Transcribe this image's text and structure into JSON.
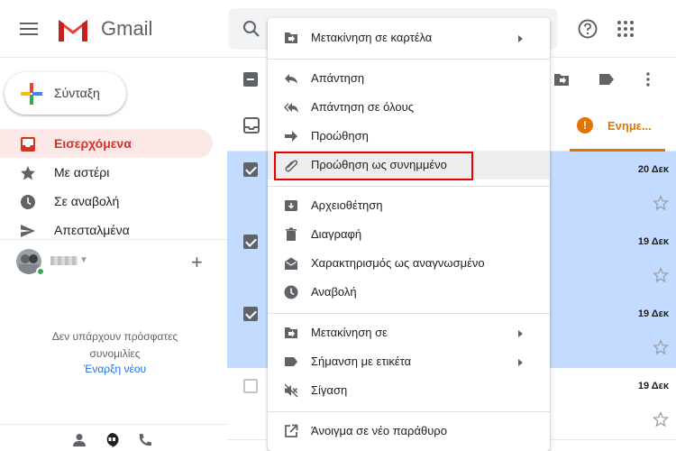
{
  "header": {
    "logo_text": "Gmail",
    "icons": [
      "menu-icon",
      "gmail-logo",
      "search-icon",
      "help-icon",
      "apps-icon"
    ]
  },
  "sidebar": {
    "compose_label": "Σύνταξη",
    "items": [
      {
        "label": "Εισερχόμενα",
        "icon": "inbox-icon",
        "active": true
      },
      {
        "label": "Με αστέρι",
        "icon": "star-icon",
        "active": false
      },
      {
        "label": "Σε αναβολή",
        "icon": "clock-icon",
        "active": false
      },
      {
        "label": "Απεσταλμένα",
        "icon": "send-icon",
        "active": false
      }
    ],
    "hangouts": {
      "no_conversations": "Δεν υπάρχουν πρόσφατες συνομιλίες",
      "start_new": "Έναρξη νέου"
    }
  },
  "tabs": {
    "updates_label": "Ενημε..."
  },
  "rows": [
    {
      "date": "20 Δεκ",
      "selected": true
    },
    {
      "date": "19 Δεκ",
      "selected": true
    },
    {
      "date": "19 Δεκ",
      "selected": true
    },
    {
      "date": "19 Δεκ",
      "selected": false
    }
  ],
  "context_menu": {
    "items": [
      {
        "label": "Μετακίνηση σε καρτέλα",
        "icon": "move-to-tab-icon",
        "submenu": true
      },
      {
        "label": "Απάντηση",
        "icon": "reply-icon",
        "submenu": false
      },
      {
        "label": "Απάντηση σε όλους",
        "icon": "reply-all-icon",
        "submenu": false
      },
      {
        "label": "Προώθηση",
        "icon": "forward-icon",
        "submenu": false
      },
      {
        "label": "Προώθηση ως συνημμένο",
        "icon": "attachment-icon",
        "submenu": false,
        "highlighted": true
      },
      {
        "label": "Αρχειοθέτηση",
        "icon": "archive-icon",
        "submenu": false
      },
      {
        "label": "Διαγραφή",
        "icon": "delete-icon",
        "submenu": false
      },
      {
        "label": "Χαρακτηρισμός ως αναγνωσμένο",
        "icon": "mark-read-icon",
        "submenu": false
      },
      {
        "label": "Αναβολή",
        "icon": "snooze-icon",
        "submenu": false
      },
      {
        "label": "Μετακίνηση σε",
        "icon": "move-to-icon",
        "submenu": true
      },
      {
        "label": "Σήμανση με ετικέτα",
        "icon": "label-icon",
        "submenu": true
      },
      {
        "label": "Σίγαση",
        "icon": "mute-icon",
        "submenu": false
      },
      {
        "label": "Άνοιγμα σε νέο παράθυρο",
        "icon": "open-new-window-icon",
        "submenu": false
      }
    ]
  },
  "colors": {
    "brand_red": "#d93025",
    "selected_row": "#c2dbff",
    "updates_orange": "#e37400",
    "highlight_box": "#e00000"
  }
}
